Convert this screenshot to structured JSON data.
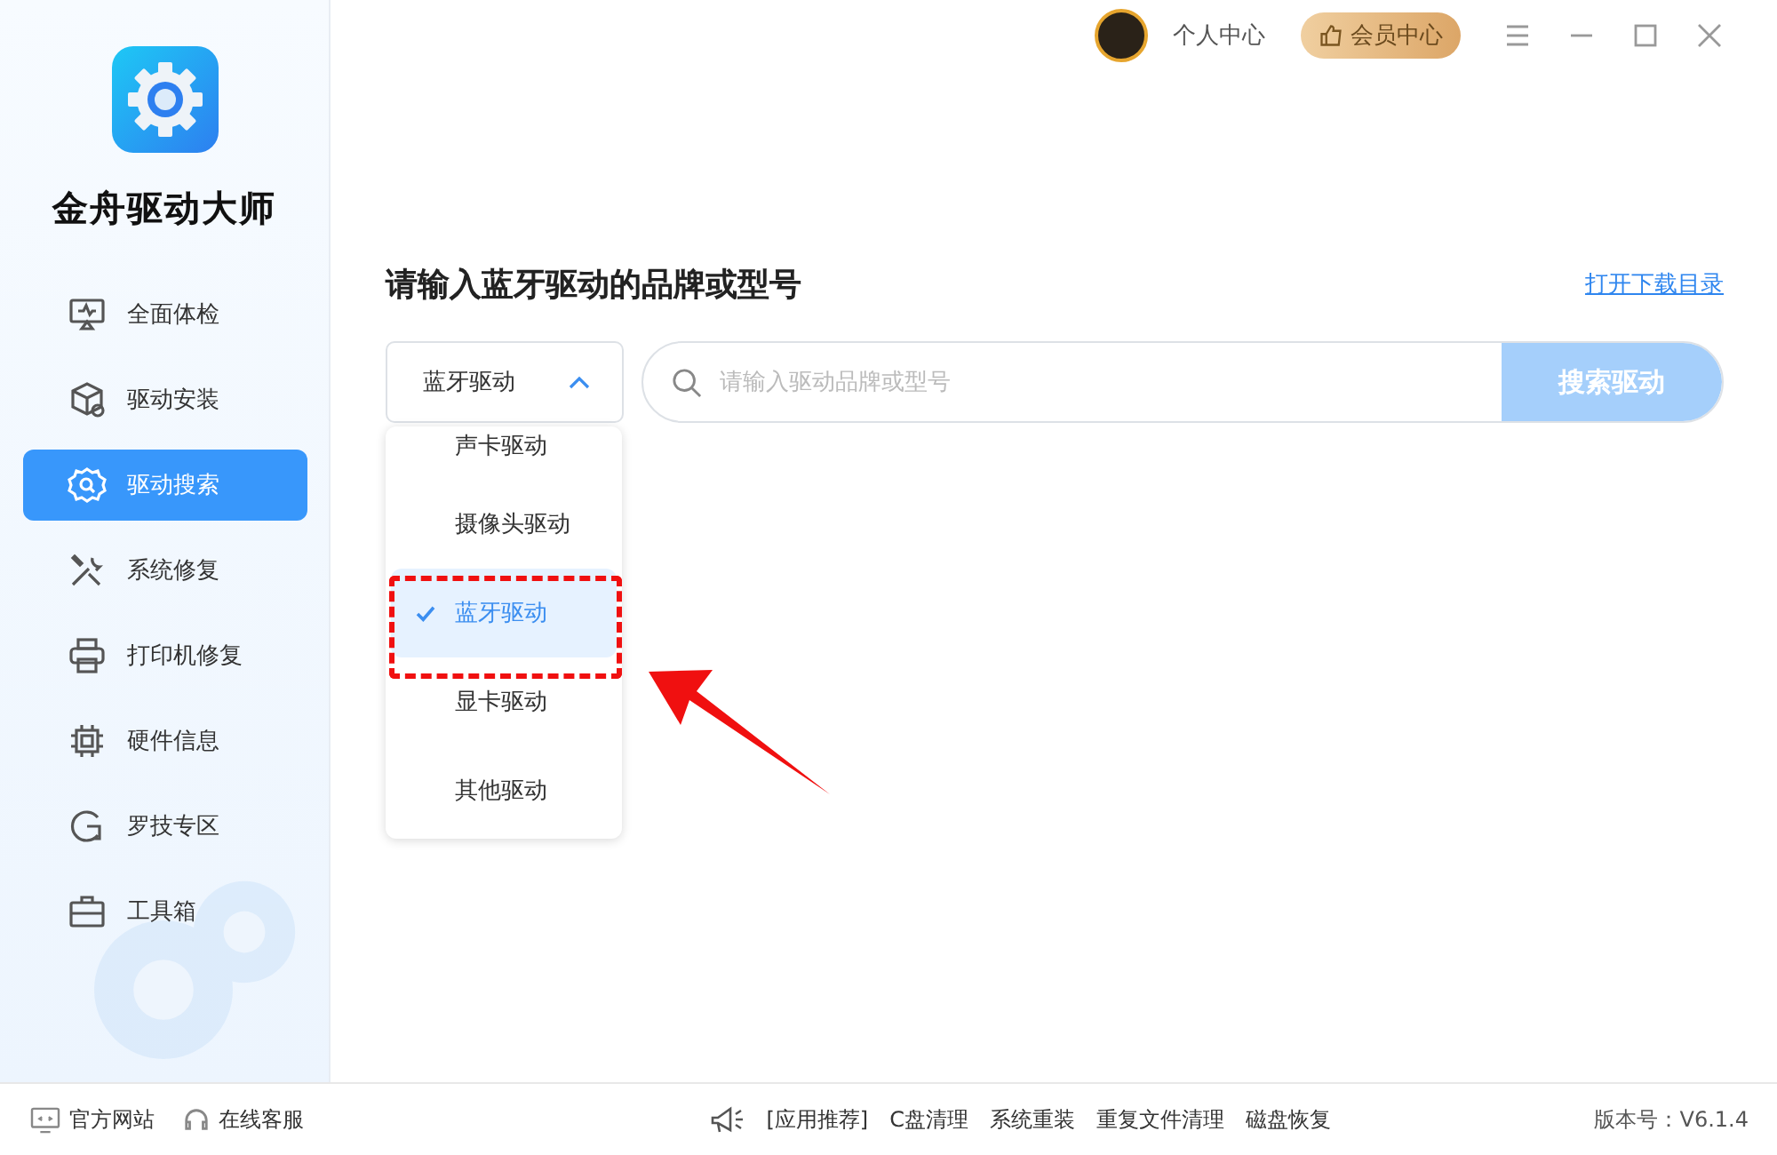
{
  "app": {
    "name": "金舟驱动大师"
  },
  "nav": [
    {
      "label": "全面体检",
      "selected": false
    },
    {
      "label": "驱动安装",
      "selected": false
    },
    {
      "label": "驱动搜索",
      "selected": true
    },
    {
      "label": "系统修复",
      "selected": false
    },
    {
      "label": "打印机修复",
      "selected": false
    },
    {
      "label": "硬件信息",
      "selected": false
    },
    {
      "label": "罗技专区",
      "selected": false
    },
    {
      "label": "工具箱",
      "selected": false
    }
  ],
  "header": {
    "account": "个人中心",
    "vip": "会员中心"
  },
  "search": {
    "title": "请输入蓝牙驱动的品牌或型号",
    "download_link": "打开下载目录",
    "category": {
      "value": "蓝牙驱动",
      "expanded": true,
      "options": [
        {
          "label": "声卡驱动",
          "selected": false
        },
        {
          "label": "摄像头驱动",
          "selected": false
        },
        {
          "label": "蓝牙驱动",
          "selected": true
        },
        {
          "label": "显卡驱动",
          "selected": false
        },
        {
          "label": "其他驱动",
          "selected": false
        }
      ]
    },
    "placeholder": "请输入驱动品牌或型号",
    "button": "搜索驱动"
  },
  "footer": {
    "links": [
      "官方网站",
      "在线客服"
    ],
    "promo_label": "[应用推荐]",
    "promos": [
      "C盘清理",
      "系统重装",
      "重复文件清理",
      "磁盘恢复"
    ],
    "version": "版本号：V6.1.4"
  }
}
